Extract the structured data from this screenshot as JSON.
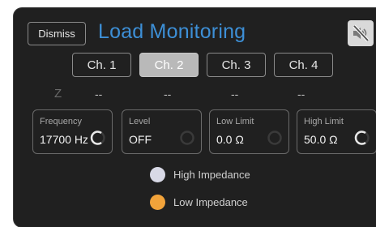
{
  "header": {
    "dismiss_label": "Dismiss",
    "title": "Load Monitoring",
    "mute_icon": "speaker-muted-icon"
  },
  "channels": [
    {
      "label": "Ch. 1",
      "active": false
    },
    {
      "label": "Ch. 2",
      "active": true
    },
    {
      "label": "Ch. 3",
      "active": false
    },
    {
      "label": "Ch. 4",
      "active": false
    }
  ],
  "impedance": {
    "label": "Z",
    "values": [
      "--",
      "--",
      "--",
      "--"
    ]
  },
  "fields": [
    {
      "label": "Frequency",
      "value": "17700 Hz"
    },
    {
      "label": "Level",
      "value": "OFF"
    },
    {
      "label": "Low Limit",
      "value": "0.0 Ω"
    },
    {
      "label": "High Limit",
      "value": "50.0 Ω"
    }
  ],
  "legend": [
    {
      "label": "High Impedance",
      "color": "#d8d9e6"
    },
    {
      "label": "Low Impedance",
      "color": "#f2a33a"
    }
  ],
  "colors": {
    "accent": "#3d8fd6",
    "panel": "#202020"
  }
}
